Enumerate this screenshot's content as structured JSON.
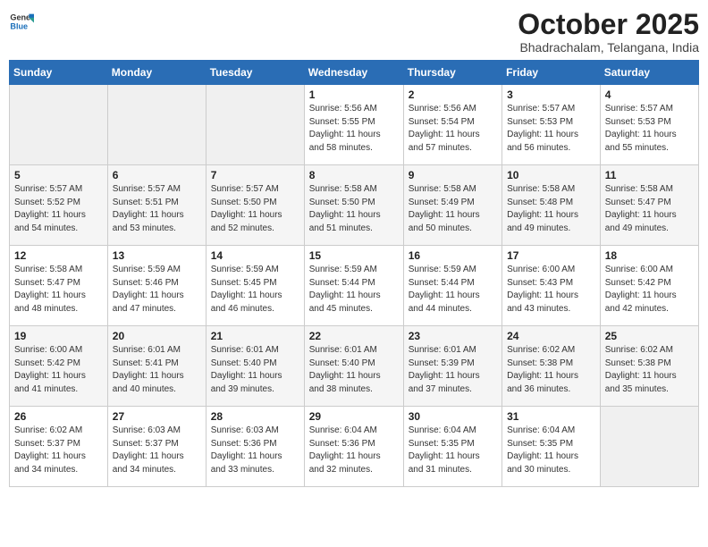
{
  "logo": {
    "text_general": "General",
    "text_blue": "Blue"
  },
  "title": "October 2025",
  "subtitle": "Bhadrachalam, Telangana, India",
  "header_days": [
    "Sunday",
    "Monday",
    "Tuesday",
    "Wednesday",
    "Thursday",
    "Friday",
    "Saturday"
  ],
  "weeks": [
    [
      {
        "day": "",
        "info": ""
      },
      {
        "day": "",
        "info": ""
      },
      {
        "day": "",
        "info": ""
      },
      {
        "day": "1",
        "info": "Sunrise: 5:56 AM\nSunset: 5:55 PM\nDaylight: 11 hours\nand 58 minutes."
      },
      {
        "day": "2",
        "info": "Sunrise: 5:56 AM\nSunset: 5:54 PM\nDaylight: 11 hours\nand 57 minutes."
      },
      {
        "day": "3",
        "info": "Sunrise: 5:57 AM\nSunset: 5:53 PM\nDaylight: 11 hours\nand 56 minutes."
      },
      {
        "day": "4",
        "info": "Sunrise: 5:57 AM\nSunset: 5:53 PM\nDaylight: 11 hours\nand 55 minutes."
      }
    ],
    [
      {
        "day": "5",
        "info": "Sunrise: 5:57 AM\nSunset: 5:52 PM\nDaylight: 11 hours\nand 54 minutes."
      },
      {
        "day": "6",
        "info": "Sunrise: 5:57 AM\nSunset: 5:51 PM\nDaylight: 11 hours\nand 53 minutes."
      },
      {
        "day": "7",
        "info": "Sunrise: 5:57 AM\nSunset: 5:50 PM\nDaylight: 11 hours\nand 52 minutes."
      },
      {
        "day": "8",
        "info": "Sunrise: 5:58 AM\nSunset: 5:50 PM\nDaylight: 11 hours\nand 51 minutes."
      },
      {
        "day": "9",
        "info": "Sunrise: 5:58 AM\nSunset: 5:49 PM\nDaylight: 11 hours\nand 50 minutes."
      },
      {
        "day": "10",
        "info": "Sunrise: 5:58 AM\nSunset: 5:48 PM\nDaylight: 11 hours\nand 49 minutes."
      },
      {
        "day": "11",
        "info": "Sunrise: 5:58 AM\nSunset: 5:47 PM\nDaylight: 11 hours\nand 49 minutes."
      }
    ],
    [
      {
        "day": "12",
        "info": "Sunrise: 5:58 AM\nSunset: 5:47 PM\nDaylight: 11 hours\nand 48 minutes."
      },
      {
        "day": "13",
        "info": "Sunrise: 5:59 AM\nSunset: 5:46 PM\nDaylight: 11 hours\nand 47 minutes."
      },
      {
        "day": "14",
        "info": "Sunrise: 5:59 AM\nSunset: 5:45 PM\nDaylight: 11 hours\nand 46 minutes."
      },
      {
        "day": "15",
        "info": "Sunrise: 5:59 AM\nSunset: 5:44 PM\nDaylight: 11 hours\nand 45 minutes."
      },
      {
        "day": "16",
        "info": "Sunrise: 5:59 AM\nSunset: 5:44 PM\nDaylight: 11 hours\nand 44 minutes."
      },
      {
        "day": "17",
        "info": "Sunrise: 6:00 AM\nSunset: 5:43 PM\nDaylight: 11 hours\nand 43 minutes."
      },
      {
        "day": "18",
        "info": "Sunrise: 6:00 AM\nSunset: 5:42 PM\nDaylight: 11 hours\nand 42 minutes."
      }
    ],
    [
      {
        "day": "19",
        "info": "Sunrise: 6:00 AM\nSunset: 5:42 PM\nDaylight: 11 hours\nand 41 minutes."
      },
      {
        "day": "20",
        "info": "Sunrise: 6:01 AM\nSunset: 5:41 PM\nDaylight: 11 hours\nand 40 minutes."
      },
      {
        "day": "21",
        "info": "Sunrise: 6:01 AM\nSunset: 5:40 PM\nDaylight: 11 hours\nand 39 minutes."
      },
      {
        "day": "22",
        "info": "Sunrise: 6:01 AM\nSunset: 5:40 PM\nDaylight: 11 hours\nand 38 minutes."
      },
      {
        "day": "23",
        "info": "Sunrise: 6:01 AM\nSunset: 5:39 PM\nDaylight: 11 hours\nand 37 minutes."
      },
      {
        "day": "24",
        "info": "Sunrise: 6:02 AM\nSunset: 5:38 PM\nDaylight: 11 hours\nand 36 minutes."
      },
      {
        "day": "25",
        "info": "Sunrise: 6:02 AM\nSunset: 5:38 PM\nDaylight: 11 hours\nand 35 minutes."
      }
    ],
    [
      {
        "day": "26",
        "info": "Sunrise: 6:02 AM\nSunset: 5:37 PM\nDaylight: 11 hours\nand 34 minutes."
      },
      {
        "day": "27",
        "info": "Sunrise: 6:03 AM\nSunset: 5:37 PM\nDaylight: 11 hours\nand 34 minutes."
      },
      {
        "day": "28",
        "info": "Sunrise: 6:03 AM\nSunset: 5:36 PM\nDaylight: 11 hours\nand 33 minutes."
      },
      {
        "day": "29",
        "info": "Sunrise: 6:04 AM\nSunset: 5:36 PM\nDaylight: 11 hours\nand 32 minutes."
      },
      {
        "day": "30",
        "info": "Sunrise: 6:04 AM\nSunset: 5:35 PM\nDaylight: 11 hours\nand 31 minutes."
      },
      {
        "day": "31",
        "info": "Sunrise: 6:04 AM\nSunset: 5:35 PM\nDaylight: 11 hours\nand 30 minutes."
      },
      {
        "day": "",
        "info": ""
      }
    ]
  ]
}
